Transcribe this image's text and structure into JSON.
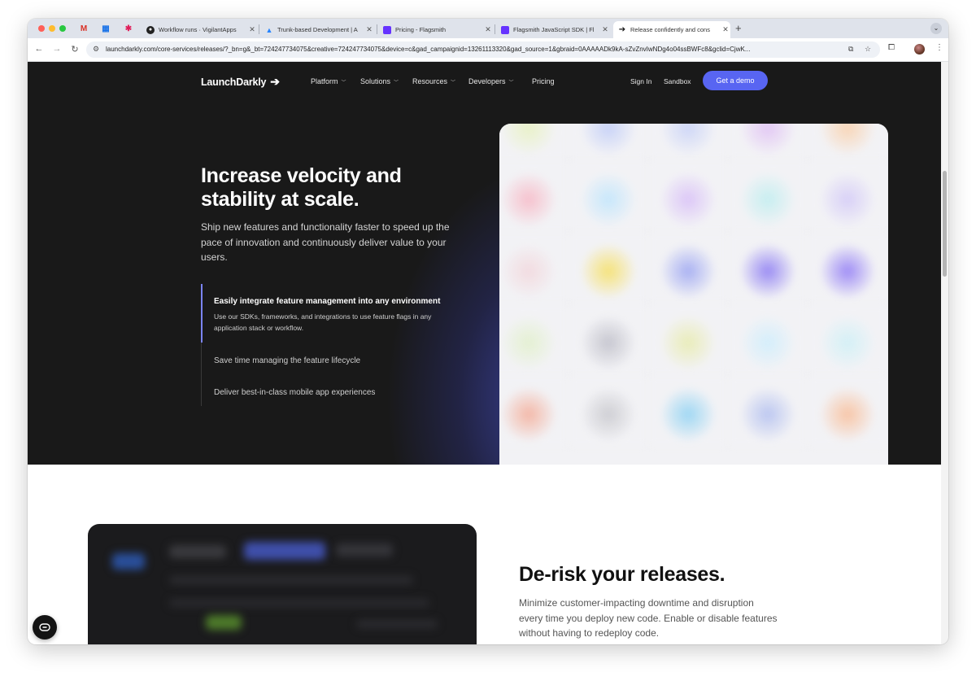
{
  "browser": {
    "pinned_tabs": [
      {
        "icon": "gmail-icon",
        "glyph": "M",
        "color": "#d93025"
      },
      {
        "icon": "calendar-icon",
        "glyph": "▦",
        "color": "#1a73e8"
      },
      {
        "icon": "slack-icon",
        "glyph": "✱",
        "color": "#e01e5a"
      }
    ],
    "tabs": [
      {
        "title": "Workflow runs · VigilantApps",
        "icon": "github-icon",
        "active": false
      },
      {
        "title": "Trunk-based Development | A",
        "icon": "atlassian-icon",
        "active": false
      },
      {
        "title": "Pricing - Flagsmith",
        "icon": "flagsmith-icon",
        "active": false
      },
      {
        "title": "Flagsmith JavaScript SDK | Fl",
        "icon": "flagsmith-icon",
        "active": false
      },
      {
        "title": "Release confidently and cons",
        "icon": "launchdarkly-icon",
        "active": true
      }
    ],
    "url": "launchdarkly.com/core-services/releases/?_bn=g&_bt=724247734075&creative=724247734075&device=c&gad_campaignid=13261113320&gad_source=1&gbraid=0AAAAADk9kA-sZvZnvIwNDg4o04ssBWFc8&gclid=CjwK..."
  },
  "nav": {
    "logo": "LaunchDarkly",
    "items": [
      "Platform",
      "Solutions",
      "Resources",
      "Developers"
    ],
    "pricing": "Pricing",
    "sign_in": "Sign In",
    "sandbox": "Sandbox",
    "cta": "Get a demo"
  },
  "hero": {
    "title": "Increase velocity and stability at scale.",
    "subtitle": "Ship new features and functionality faster to speed up the pace of innovation and continuously deliver value to your users.",
    "features": [
      {
        "title": "Easily integrate feature management into any environment",
        "desc": "Use our SDKs,  frameworks, and integrations to use feature flags in any application stack or workflow.",
        "active": true
      },
      {
        "title": "Save time managing the feature lifecycle",
        "active": false
      },
      {
        "title": "Deliver best-in-class mobile app experiences",
        "active": false
      }
    ]
  },
  "section2": {
    "title": "De-risk your releases.",
    "body": "Minimize customer-impacting downtime and disruption every time you deploy new code. Enable or disable features without having to redeploy code."
  },
  "colors": {
    "accent": "#5865f2",
    "hero_bg": "#191919"
  }
}
